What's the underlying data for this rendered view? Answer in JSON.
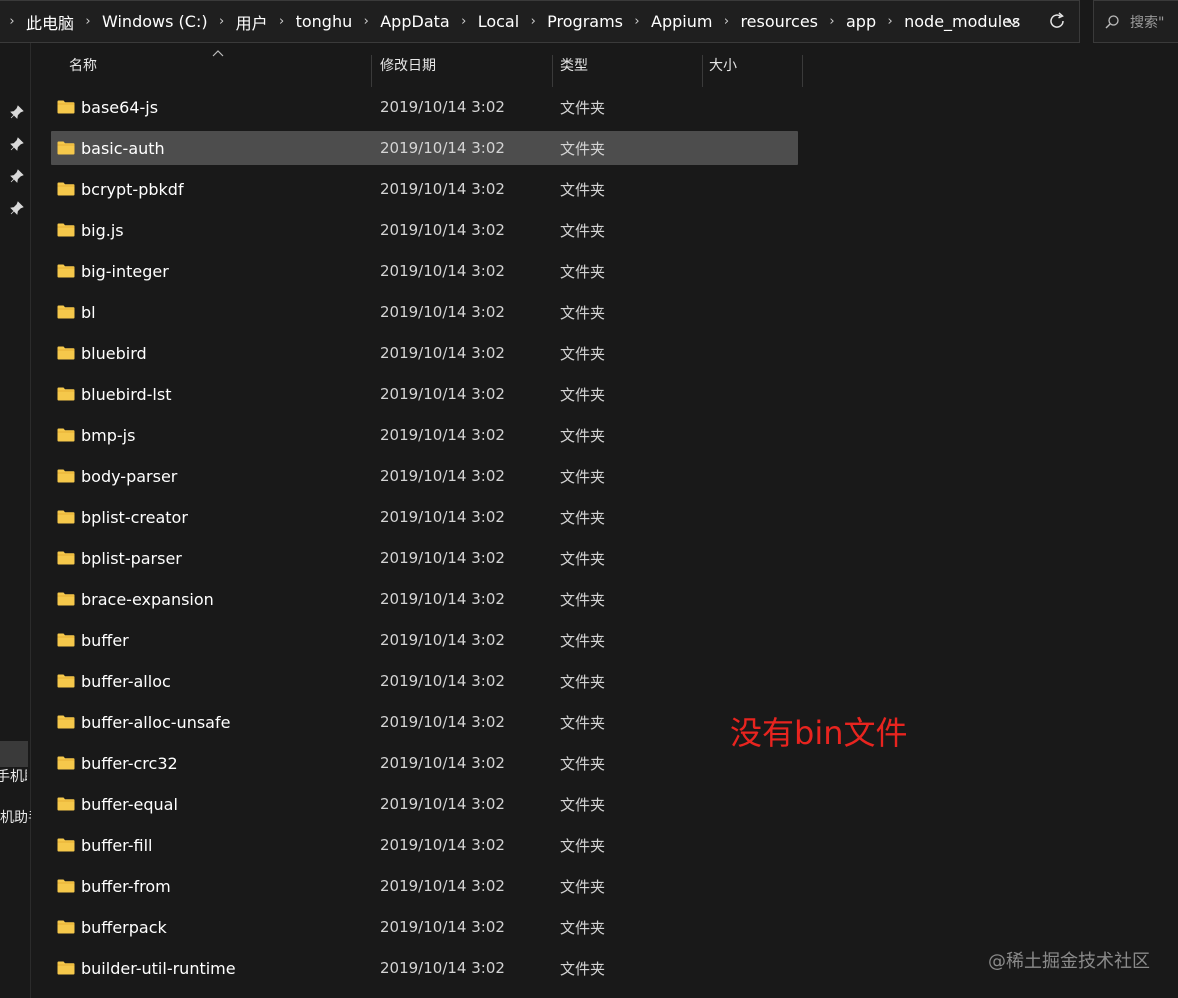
{
  "addressbar": {
    "breadcrumbs": [
      "此电脑",
      "Windows (C:)",
      "用户",
      "tonghu",
      "AppData",
      "Local",
      "Programs",
      "Appium",
      "resources",
      "app",
      "node_modules"
    ]
  },
  "search": {
    "placeholder": "搜索\""
  },
  "navpane": {
    "labels": [
      "手机助",
      "机助手"
    ]
  },
  "columns": {
    "name": "名称",
    "date": "修改日期",
    "type": "类型",
    "size": "大小"
  },
  "files": [
    {
      "name": "base64-js",
      "date": "2019/10/14 3:02",
      "type": "文件夹"
    },
    {
      "name": "basic-auth",
      "date": "2019/10/14 3:02",
      "type": "文件夹",
      "selected": true
    },
    {
      "name": "bcrypt-pbkdf",
      "date": "2019/10/14 3:02",
      "type": "文件夹"
    },
    {
      "name": "big.js",
      "date": "2019/10/14 3:02",
      "type": "文件夹"
    },
    {
      "name": "big-integer",
      "date": "2019/10/14 3:02",
      "type": "文件夹"
    },
    {
      "name": "bl",
      "date": "2019/10/14 3:02",
      "type": "文件夹"
    },
    {
      "name": "bluebird",
      "date": "2019/10/14 3:02",
      "type": "文件夹"
    },
    {
      "name": "bluebird-lst",
      "date": "2019/10/14 3:02",
      "type": "文件夹"
    },
    {
      "name": "bmp-js",
      "date": "2019/10/14 3:02",
      "type": "文件夹"
    },
    {
      "name": "body-parser",
      "date": "2019/10/14 3:02",
      "type": "文件夹"
    },
    {
      "name": "bplist-creator",
      "date": "2019/10/14 3:02",
      "type": "文件夹"
    },
    {
      "name": "bplist-parser",
      "date": "2019/10/14 3:02",
      "type": "文件夹"
    },
    {
      "name": "brace-expansion",
      "date": "2019/10/14 3:02",
      "type": "文件夹"
    },
    {
      "name": "buffer",
      "date": "2019/10/14 3:02",
      "type": "文件夹"
    },
    {
      "name": "buffer-alloc",
      "date": "2019/10/14 3:02",
      "type": "文件夹"
    },
    {
      "name": "buffer-alloc-unsafe",
      "date": "2019/10/14 3:02",
      "type": "文件夹"
    },
    {
      "name": "buffer-crc32",
      "date": "2019/10/14 3:02",
      "type": "文件夹"
    },
    {
      "name": "buffer-equal",
      "date": "2019/10/14 3:02",
      "type": "文件夹"
    },
    {
      "name": "buffer-fill",
      "date": "2019/10/14 3:02",
      "type": "文件夹"
    },
    {
      "name": "buffer-from",
      "date": "2019/10/14 3:02",
      "type": "文件夹"
    },
    {
      "name": "bufferpack",
      "date": "2019/10/14 3:02",
      "type": "文件夹"
    },
    {
      "name": "builder-util-runtime",
      "date": "2019/10/14 3:02",
      "type": "文件夹"
    }
  ],
  "annotation": "没有bin文件",
  "watermark": "@稀土掘金技术社区",
  "colors": {
    "folder": "#f5c84b",
    "annotation": "#e8241f",
    "selected_row": "#4d4d4d",
    "background": "#191919"
  },
  "icons": [
    "chevron-right-icon",
    "chevron-down-icon",
    "refresh-icon",
    "search-icon",
    "pin-icon",
    "folder-icon",
    "sort-up-icon"
  ]
}
